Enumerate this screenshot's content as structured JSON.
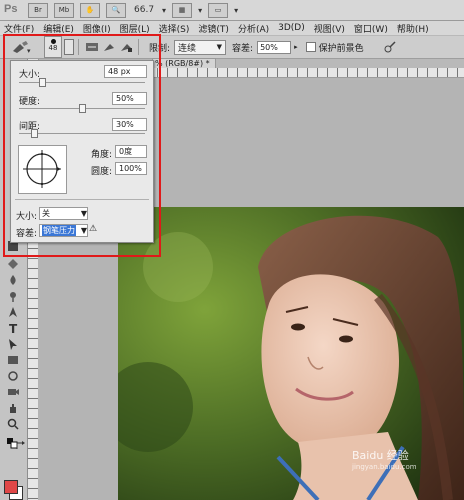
{
  "app": {
    "logo_text": "Ps",
    "zoom_value": "66.7",
    "bar_icons": [
      "br-icon",
      "mb-icon",
      "hand-icon",
      "zoom-icon",
      "layout-icon",
      "screen-mode-icon"
    ]
  },
  "menu": {
    "items": [
      "文件(F)",
      "编辑(E)",
      "图像(I)",
      "图层(L)",
      "选择(S)",
      "滤镜(T)",
      "分析(A)",
      "3D(D)",
      "视图(V)",
      "窗口(W)",
      "帮助(H)"
    ]
  },
  "options_bar": {
    "brush_size": "48",
    "limit_label": "限制:",
    "limit_value": "连续",
    "tolerance_label": "容差:",
    "tolerance_value": "50%",
    "protect_fg_label": "保护前景色"
  },
  "document_tab": {
    "title": "% (RGB/8#) *"
  },
  "brush_panel": {
    "size_label": "大小:",
    "size_value": "48 px",
    "hardness_label": "硬度:",
    "hardness_value": "50%",
    "spacing_label": "间距:",
    "spacing_value": "30%",
    "angle_label": "角度:",
    "angle_value": "0度",
    "roundness_label": "圆度:",
    "roundness_value": "100%",
    "size_jitter_label": "大小:",
    "size_jitter_value": "关",
    "tolerance_label": "容差:",
    "tolerance_value": "钢笔压力"
  },
  "levels": {
    "size_slider": 0.18,
    "hardness_slider": 0.5,
    "spacing_slider": 0.12
  },
  "colors": {
    "foreground": "#e04747",
    "background": "#ffffff",
    "highlight": "#e01919"
  },
  "watermark": {
    "text": "Baidu 经验",
    "sub": "jingyan.baidu.com"
  }
}
